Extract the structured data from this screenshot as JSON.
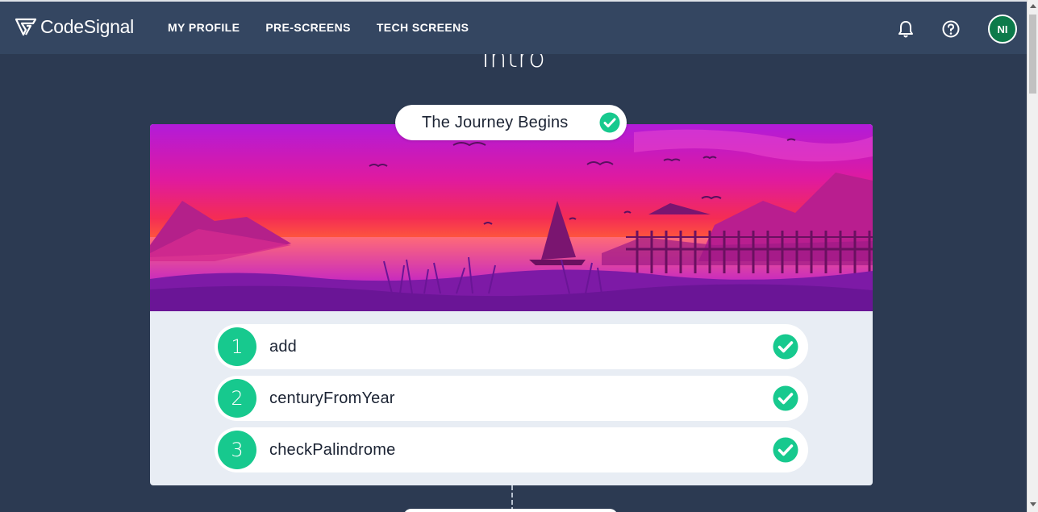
{
  "brand": {
    "name": "CodeSignal",
    "logo_icon": "codesignal-logo-icon"
  },
  "nav": {
    "items": [
      {
        "label": "MY PROFILE"
      },
      {
        "label": "PRE-SCREENS"
      },
      {
        "label": "TECH SCREENS"
      }
    ]
  },
  "header": {
    "notifications_icon": "bell-icon",
    "help_icon": "help-circle-icon",
    "avatar_initials": "NI",
    "avatar_color": "#0c7a4a"
  },
  "section": {
    "title": "Intro"
  },
  "arcade": {
    "badge_label": "The Journey Begins",
    "badge_status": "completed",
    "tasks": [
      {
        "number": "1",
        "name": "add",
        "status": "completed"
      },
      {
        "number": "2",
        "name": "centuryFromYear",
        "status": "completed"
      },
      {
        "number": "3",
        "name": "checkPalindrome",
        "status": "completed"
      }
    ]
  },
  "colors": {
    "page_bg": "#2c3a52",
    "topbar_bg": "#344661",
    "accent_green": "#17c98e",
    "card_bg": "#e8edf4"
  }
}
